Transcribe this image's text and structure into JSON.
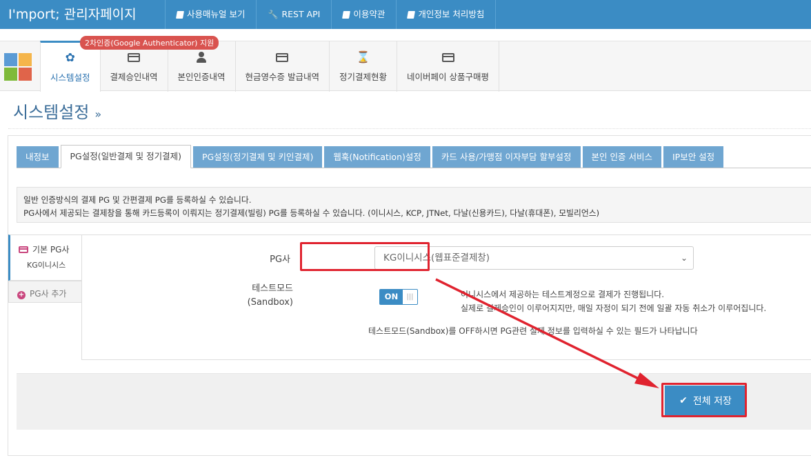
{
  "app": {
    "title": "I'mport; 관리자페이지"
  },
  "topnav": [
    {
      "label": "사용매뉴얼 보기",
      "icon": "book-icon"
    },
    {
      "label": "REST API",
      "icon": "wrench-icon"
    },
    {
      "label": "이용약관",
      "icon": "book-icon"
    },
    {
      "label": "개인정보 처리방침",
      "icon": "book-icon"
    }
  ],
  "menu": {
    "badge": "2차인증(Google Authenticator) 지원",
    "items": [
      {
        "label": "시스템설정",
        "icon": "gear-icon",
        "active": true
      },
      {
        "label": "결제승인내역",
        "icon": "credit-card-icon"
      },
      {
        "label": "본인인증내역",
        "icon": "user-icon"
      },
      {
        "label": "현금영수증 발급내역",
        "icon": "credit-card-icon"
      },
      {
        "label": "정기결제현황",
        "icon": "hourglass-icon"
      },
      {
        "label": "네이버페이 상품구매평",
        "icon": "credit-card-icon"
      }
    ]
  },
  "page": {
    "title": "시스템설정",
    "title_suffix": "»"
  },
  "tabs": [
    {
      "label": "내정보"
    },
    {
      "label": "PG설정(일반결제 및 정기결제)",
      "active": true
    },
    {
      "label": "PG설정(정기결제 및 키인결제)"
    },
    {
      "label": "웹훅(Notification)설정"
    },
    {
      "label": "카드 사용/가맹점 이자부담 할부설정"
    },
    {
      "label": "본인 인증 서비스"
    },
    {
      "label": "IP보안 설정"
    }
  ],
  "info": {
    "line1": "일반 인증방식의 결제 PG 및 간편결제 PG를 등록하실 수 있습니다.",
    "line2": "PG사에서 제공되는 결제창을 통해 카드등록이 이뤄지는 정기결제(빌링) PG를 등록하실 수 있습니다. (이니시스, KCP, JTNet, 다날(신용카드), 다날(휴대폰), 모빌리언스)"
  },
  "side": {
    "primary_label": "기본 PG사",
    "primary_sub": "KG이니시스",
    "add_label": "PG사 추가"
  },
  "form": {
    "pg_label": "PG사",
    "pg_value": "KG이니시스(웹표준결제창)",
    "test_label_1": "테스트모드",
    "test_label_2": "(Sandbox)",
    "toggle_on": "ON",
    "desc_1": "이니시스에서 제공하는 테스트계정으로 결제가 진행됩니다.",
    "desc_2": "실제로 결제승인이 이루어지지만, 매일 자정이 되기 전에 일괄 자동 취소가 이루어집니다.",
    "note": "테스트모드(Sandbox)를 OFF하시면 PG관련 실제 정보를 입력하실 수 있는 필드가 나타납니다"
  },
  "actions": {
    "save_label": "전체 저장"
  },
  "colors": {
    "primary": "#3b8cc4",
    "tab": "#6fa6d1",
    "highlight": "#e0232f",
    "badge": "#d9534f"
  }
}
